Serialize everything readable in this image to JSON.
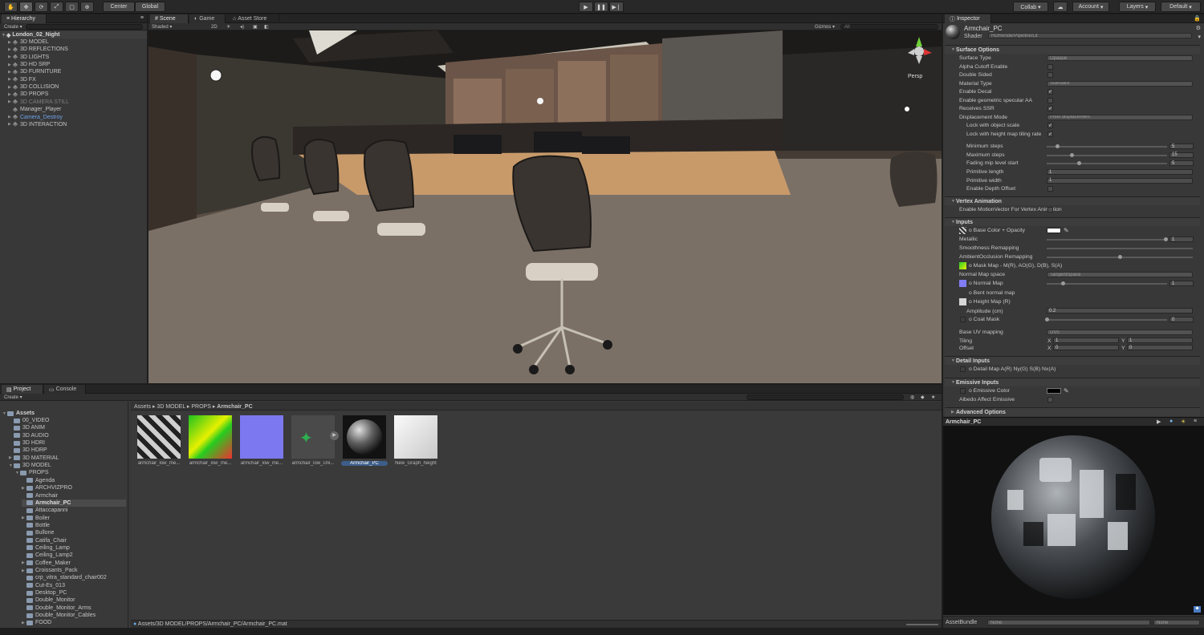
{
  "toolbar": {
    "center": "Center",
    "global": "Global",
    "collab": "Collab ▾",
    "account": "Account",
    "layers": "Layers",
    "layout": "Default"
  },
  "hierarchy": {
    "tab": "Hierarchy",
    "create": "Create ▾",
    "scene": "London_02_Night",
    "items": [
      "3D MODEL",
      "3D REFLECTIONS",
      "3D LIGHTS",
      "3D HD SRP",
      "3D FURNITURE",
      "3D FX",
      "3D COLLISION",
      "3D PROPS",
      "3D CAMERA STILL",
      "Manager_Player",
      "Camera_Destroy",
      "3D INTERACTION"
    ]
  },
  "scene_tabs": {
    "scene": "Scene",
    "game": "Game",
    "asset_store": "Asset Store"
  },
  "scene_bar": {
    "shaded": "Shaded",
    "mode_2d": "2D",
    "gizmos": "Gizmos",
    "search": "All"
  },
  "scene_view": {
    "persp": "Persp"
  },
  "project": {
    "tab_project": "Project",
    "tab_console": "Console",
    "create": "Create ▾",
    "root": "Assets",
    "tree": [
      "00_VIDEO",
      "3D ANIM",
      "3D AUDIO",
      "3D HDRI",
      "3D HDRP",
      "3D MATERIAL",
      "3D MODEL",
      "PROPS",
      "Agenda",
      "ARCHVIZPRO",
      "Armchair",
      "Armchair_PC",
      "Attaccapanni",
      "Boiler",
      "Bottle",
      "Bullone",
      "Catifa_Chair",
      "Ceiling_Lamp",
      "Ceiling_Lamp2",
      "Coffee_Maker",
      "Croissants_Pack",
      "crp_vitra_standard_chair002",
      "Cut-Es_013",
      "Desktop_PC",
      "Double_Monitor",
      "Double_Monitor_Arms",
      "Double_Monitor_Cables",
      "FOOD"
    ],
    "breadcrumb": [
      "Assets",
      "3D MODEL",
      "PROPS",
      "Armchair_PC"
    ],
    "assets": [
      "armchair_low_me...",
      "armchair_low_me...",
      "armchair_low_me...",
      "armchair_low_Uni...",
      "Armchair_PC",
      "New_Graph_height"
    ],
    "footer_path": "Assets/3D MODEL/PROPS/Armchair_PC/Armchair_PC.mat"
  },
  "inspector": {
    "tab": "Inspector",
    "name": "Armchair_PC",
    "shader_label": "Shader",
    "shader": "HDRenderPipeline/Lit",
    "sections": {
      "surface": "Surface Options",
      "vertex": "Vertex Animation",
      "inputs": "Inputs",
      "detail": "Detail Inputs",
      "emissive": "Emissive Inputs",
      "advanced": "Advanced Options"
    },
    "surface": [
      {
        "label": "Surface Type",
        "value": "Opaque"
      },
      {
        "label": "Alpha Cutoff Enable",
        "check": false
      },
      {
        "label": "Double Sided",
        "check": false
      },
      {
        "label": "Material Type",
        "value": "Standard"
      },
      {
        "label": "Enable Decal",
        "check": true
      },
      {
        "label": "Enable geometric specular AA",
        "check": false
      },
      {
        "label": "Receives SSR",
        "check": true
      },
      {
        "label": "Displacement Mode",
        "value": "Pixel displacement"
      },
      {
        "label": "Lock with object scale",
        "check": true,
        "indent": true
      },
      {
        "label": "Lock with height map tiling rate",
        "check": true,
        "indent": true
      }
    ],
    "pom": [
      {
        "label": "Minimum steps",
        "value": "5",
        "pos": 0.02
      },
      {
        "label": "Maximum steps",
        "value": "15",
        "pos": 0.14
      },
      {
        "label": "Fading mip level start",
        "value": "5",
        "pos": 0.2
      }
    ],
    "prim": [
      {
        "label": "Primitive length",
        "value": "1"
      },
      {
        "label": "Primitive width",
        "value": "1"
      }
    ],
    "depth_offset": "Enable Depth Offset",
    "vertex_motion": "Enable MotionVector For Vertex Animation",
    "inputs": {
      "base_color": "o Base Color + Opacity",
      "metallic": "Metallic",
      "metallic_value": "1",
      "smoothness": "Smoothness Remapping",
      "ao": "AmbientOcclusion Remapping",
      "mask_map": "o Mask Map - M(R), AO(G), D(B), S(A)",
      "normal_space": "Normal Map space",
      "normal_space_value": "TangentSpace",
      "normal_map": "o Normal Map",
      "normal_value": "1",
      "bent": "o Bent normal map",
      "height": "o Height Map (R)",
      "amplitude": "Amplitude (cm)",
      "amplitude_value": "0.2",
      "coat": "o Coat Mask",
      "coat_value": "0",
      "uv": "Base UV mapping",
      "uv_value": "UV0",
      "tiling": "Tiling",
      "offset": "Offset",
      "tx": "1",
      "ty": "1",
      "ox": "0",
      "oy": "0",
      "x": "X",
      "y": "Y"
    },
    "detail_map": "o Detail Map A(R) Ny(G) S(B) Nx(A)",
    "emissive_color": "o Emissive Color",
    "albedo_emissive": "Albedo Affect Emissive",
    "preview_name": "Armchair_PC",
    "assetbundle": "AssetBundle",
    "ab_value": "None",
    "ab_variant": "None"
  }
}
